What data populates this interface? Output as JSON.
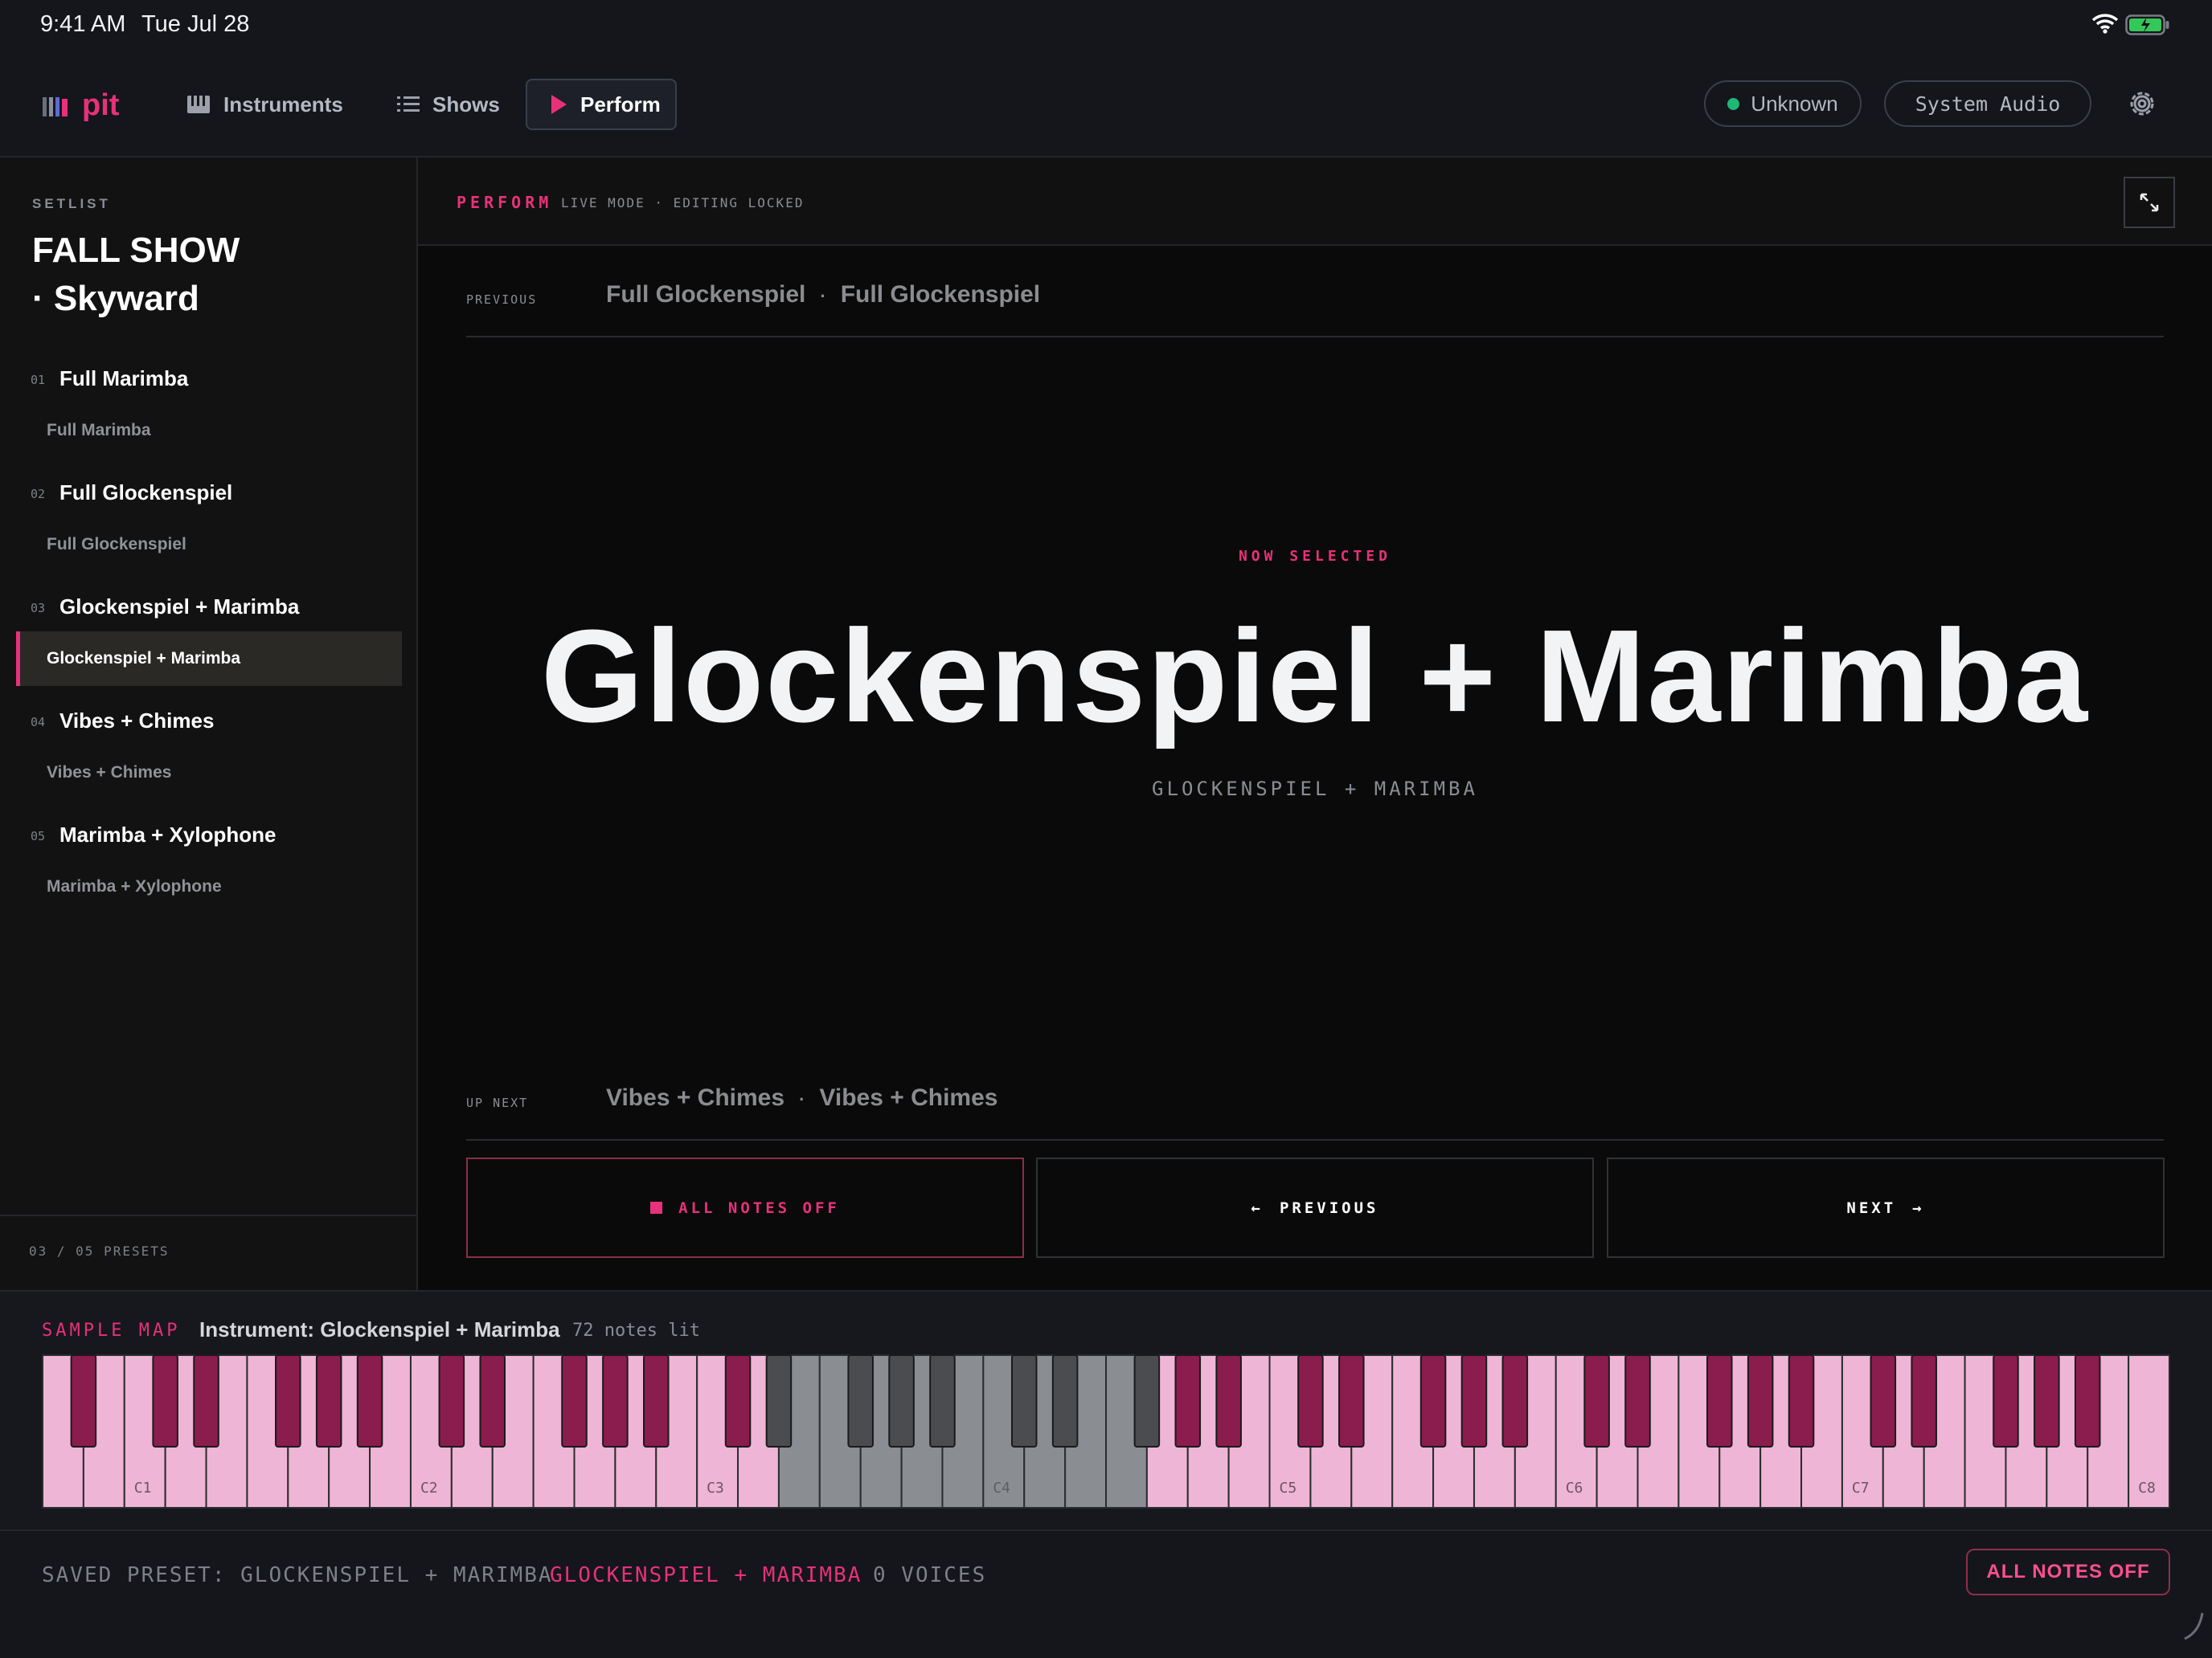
{
  "status_bar": {
    "time": "9:41 AM",
    "date": "Tue Jul 28"
  },
  "nav": {
    "app_name": "pit",
    "instruments_label": "Instruments",
    "shows_label": "Shows",
    "perform_label": "Perform",
    "status_label": "Unknown",
    "audio_label": "System Audio"
  },
  "sidebar": {
    "label": "SETLIST",
    "title": "FALL SHOW\n· Skyward",
    "items": [
      {
        "num": "01",
        "name": "Full Marimba",
        "sub": "Full Marimba",
        "active": false
      },
      {
        "num": "02",
        "name": "Full Glockenspiel",
        "sub": "Full Glockenspiel",
        "active": false
      },
      {
        "num": "03",
        "name": "Glockenspiel + Marimba",
        "sub": "Glockenspiel + Marimba",
        "active": true
      },
      {
        "num": "04",
        "name": "Vibes + Chimes",
        "sub": "Vibes + Chimes",
        "active": false
      },
      {
        "num": "05",
        "name": "Marimba + Xylophone",
        "sub": "Marimba + Xylophone",
        "active": false
      }
    ],
    "footer": "03 / 05 PRESETS"
  },
  "main": {
    "perform_label": "PERFORM",
    "mode_label": "LIVE MODE · EDITING LOCKED",
    "previous": {
      "label": "PREVIOUS",
      "name": "Full Glockenspiel",
      "sep": "·",
      "sub": "Full Glockenspiel"
    },
    "now": {
      "label": "NOW SELECTED",
      "title": "Glockenspiel + Marimba",
      "sub": "GLOCKENSPIEL + MARIMBA"
    },
    "next": {
      "label": "UP NEXT",
      "name": "Vibes + Chimes",
      "sep": "·",
      "sub": "Vibes + Chimes"
    },
    "controls": {
      "all_off": "ALL NOTES OFF",
      "previous": "PREVIOUS",
      "next": "NEXT",
      "arrow_left": "←",
      "arrow_right": "→"
    }
  },
  "sample_map": {
    "label": "SAMPLE MAP",
    "instrument": "Instrument: Glockenspiel + Marimba",
    "count": "72 notes lit",
    "octave_labels": [
      "C1",
      "C2",
      "C3",
      "C4",
      "C5",
      "C6",
      "C7",
      "C8"
    ],
    "white_key_count": 52,
    "unlit_white_range": [
      18,
      26
    ],
    "colors": {
      "lit_white": "#efb5d6",
      "lit_black": "#8a1d4e",
      "unlit_white": "#8a8d91",
      "unlit_black": "#4a4c50"
    }
  },
  "footer": {
    "saved": "SAVED PRESET: GLOCKENSPIEL + MARIMBA",
    "current": "GLOCKENSPIEL + MARIMBA",
    "voices": "0 VOICES",
    "all_off": "ALL NOTES OFF"
  },
  "colors": {
    "accent": "#e8317a",
    "background": "#14161b",
    "panel": "#0a0a0a",
    "online_dot": "#1fb877"
  },
  "icons": [
    "wifi-icon",
    "battery-icon",
    "logo-icon",
    "piano-icon",
    "list-icon",
    "play-icon",
    "gear-icon",
    "expand-icon",
    "stop-icon"
  ]
}
